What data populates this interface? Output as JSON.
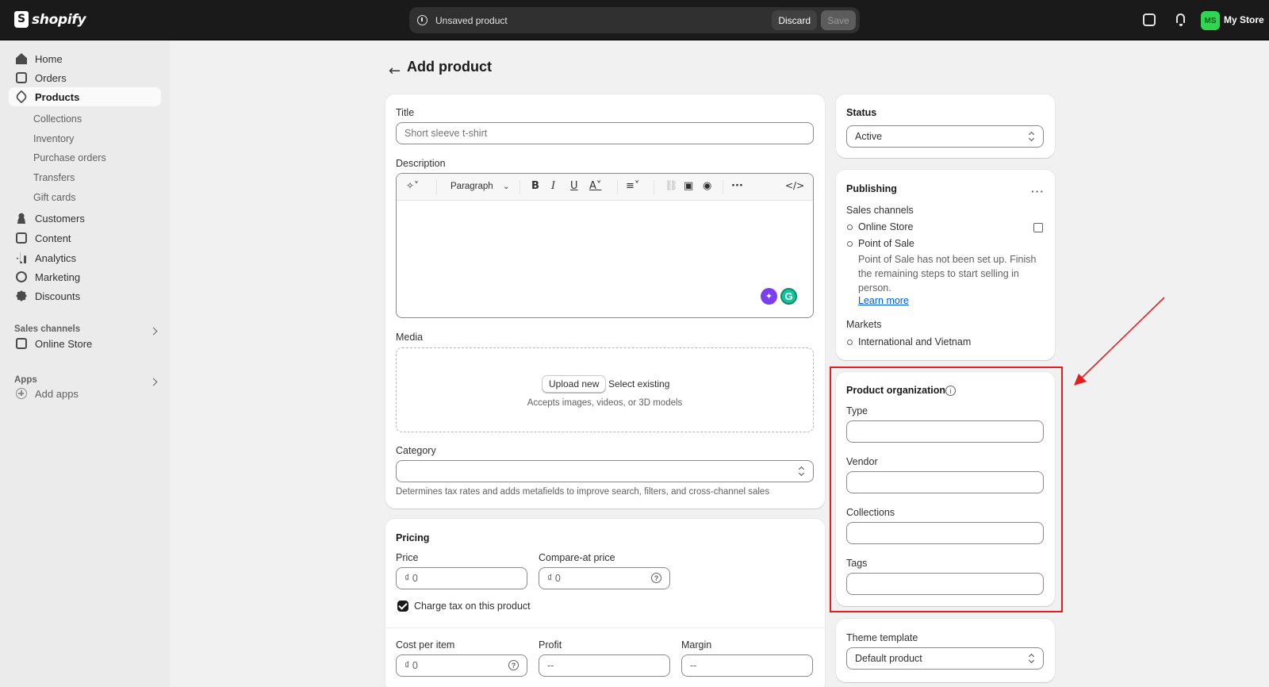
{
  "topbar": {
    "logo_text": "shopify",
    "unsaved_text": "Unsaved product",
    "discard_label": "Discard",
    "save_label": "Save",
    "avatar_initials": "MS",
    "store_name": "My Store"
  },
  "sidebar": {
    "items": [
      {
        "label": "Home",
        "icon": "home-icon"
      },
      {
        "label": "Orders",
        "icon": "orders-icon"
      },
      {
        "label": "Products",
        "icon": "tag-icon"
      },
      {
        "label": "Customers",
        "icon": "person-icon"
      },
      {
        "label": "Content",
        "icon": "content-icon"
      },
      {
        "label": "Analytics",
        "icon": "analytics-icon"
      },
      {
        "label": "Marketing",
        "icon": "marketing-icon"
      },
      {
        "label": "Discounts",
        "icon": "discount-icon"
      }
    ],
    "product_subitems": [
      "Collections",
      "Inventory",
      "Purchase orders",
      "Transfers",
      "Gift cards"
    ],
    "sales_channels_label": "Sales channels",
    "online_store_label": "Online Store",
    "apps_label": "Apps",
    "add_apps_label": "Add apps"
  },
  "page": {
    "title": "Add product"
  },
  "product": {
    "title_label": "Title",
    "title_placeholder": "Short sleeve t-shirt",
    "description_label": "Description",
    "paragraph_label": "Paragraph",
    "media_label": "Media",
    "upload_label": "Upload new",
    "select_label": "Select existing",
    "media_help": "Accepts images, videos, or 3D models",
    "category_label": "Category",
    "category_help": "Determines tax rates and adds metafields to improve search, filters, and cross-channel sales"
  },
  "pricing": {
    "heading": "Pricing",
    "price_label": "Price",
    "price_value": "₫  0",
    "compare_label": "Compare-at price",
    "compare_value": "₫  0",
    "charge_tax_label": "Charge tax on this product",
    "cost_label": "Cost per item",
    "cost_value": "₫  0",
    "profit_label": "Profit",
    "profit_value": "--",
    "margin_label": "Margin",
    "margin_value": "--"
  },
  "status": {
    "heading": "Status",
    "value": "Active"
  },
  "publishing": {
    "heading": "Publishing",
    "sales_channels_label": "Sales channels",
    "channel_online": "Online Store",
    "channel_pos": "Point of Sale",
    "pos_note": "Point of Sale has not been set up. Finish the remaining steps to start selling in person.",
    "learn_more": "Learn more",
    "markets_label": "Markets",
    "market_value": "International and Vietnam"
  },
  "organization": {
    "heading": "Product organization",
    "type_label": "Type",
    "vendor_label": "Vendor",
    "collections_label": "Collections",
    "tags_label": "Tags"
  },
  "theme": {
    "heading": "Theme template",
    "value": "Default product"
  },
  "colors": {
    "highlight": "#e31e1e",
    "avatar": "#2fd653",
    "link": "#005bd3"
  }
}
